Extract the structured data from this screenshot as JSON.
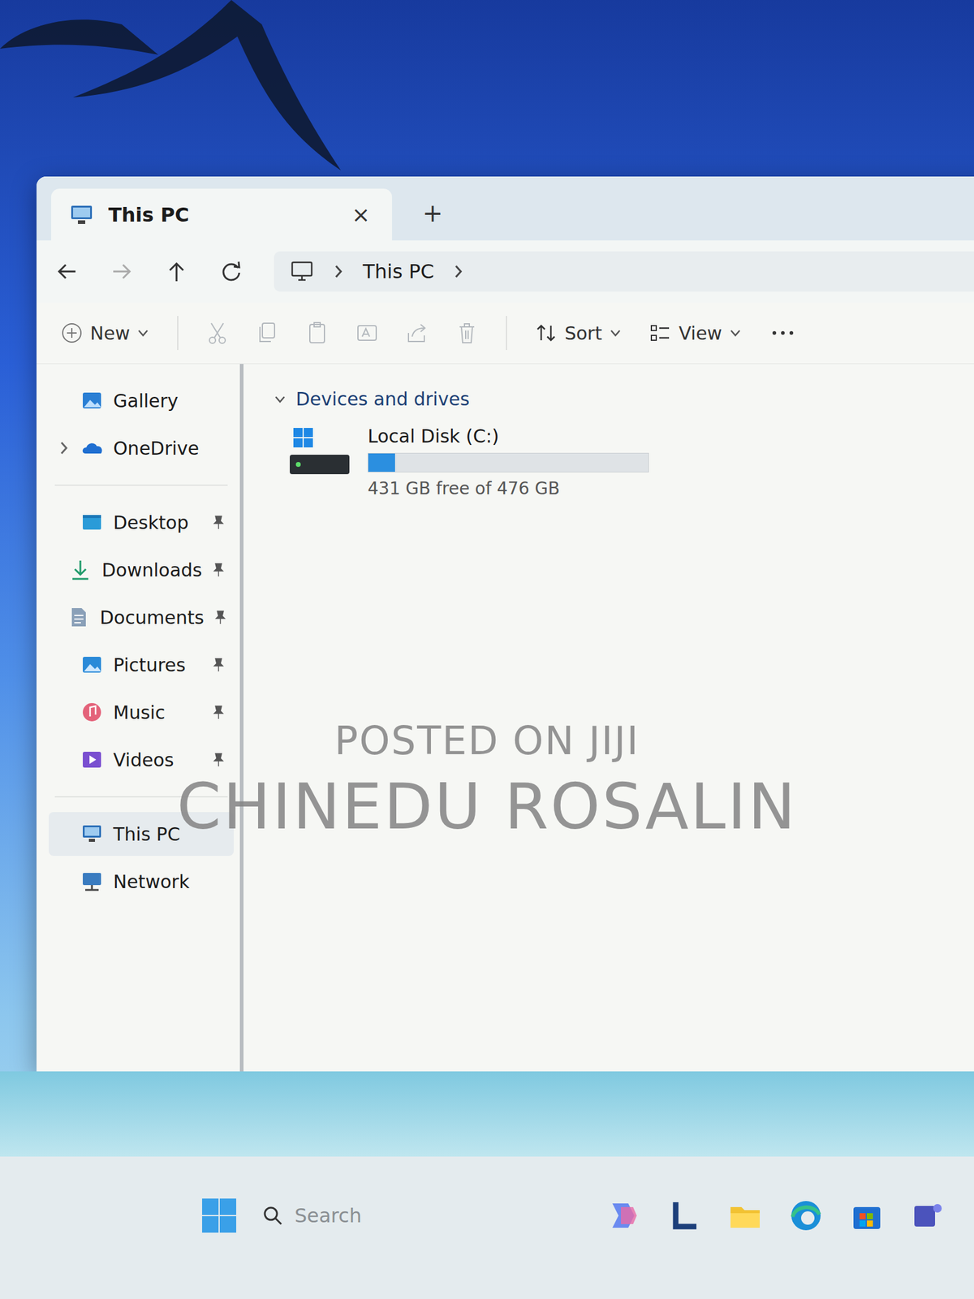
{
  "window": {
    "title": "This PC",
    "close": "×",
    "new_tab": "+"
  },
  "address": {
    "crumbs": [
      "This PC"
    ]
  },
  "toolbar": {
    "new": "New",
    "sort": "Sort",
    "view": "View"
  },
  "sidebar": {
    "groups": [
      [
        {
          "label": "Gallery",
          "pinned": false,
          "selected": false,
          "expandable": false,
          "expanded": false
        },
        {
          "label": "OneDrive",
          "pinned": false,
          "selected": false,
          "expandable": true,
          "expanded": false
        }
      ],
      [
        {
          "label": "Desktop",
          "pinned": true,
          "selected": false,
          "expandable": false,
          "expanded": false
        },
        {
          "label": "Downloads",
          "pinned": true,
          "selected": false,
          "expandable": false,
          "expanded": false
        },
        {
          "label": "Documents",
          "pinned": true,
          "selected": false,
          "expandable": false,
          "expanded": false
        },
        {
          "label": "Pictures",
          "pinned": true,
          "selected": false,
          "expandable": false,
          "expanded": false
        },
        {
          "label": "Music",
          "pinned": true,
          "selected": false,
          "expandable": false,
          "expanded": false
        },
        {
          "label": "Videos",
          "pinned": true,
          "selected": false,
          "expandable": false,
          "expanded": false
        }
      ],
      [
        {
          "label": "This PC",
          "pinned": false,
          "selected": true,
          "expandable": false,
          "expanded": false
        },
        {
          "label": "Network",
          "pinned": false,
          "selected": false,
          "expandable": false,
          "expanded": false
        }
      ]
    ]
  },
  "content": {
    "section": {
      "label": "Devices and drives",
      "expanded": true
    },
    "drives": [
      {
        "name": "Local Disk (C:)",
        "free": "431 GB free of 476 GB",
        "level": 0.095
      }
    ]
  },
  "taskbar": {
    "search": {
      "placeholder": "Search"
    }
  },
  "watermark": {
    "lines": [
      "POSTED ON JIJI",
      "CHINEDU ROSALIN"
    ]
  }
}
